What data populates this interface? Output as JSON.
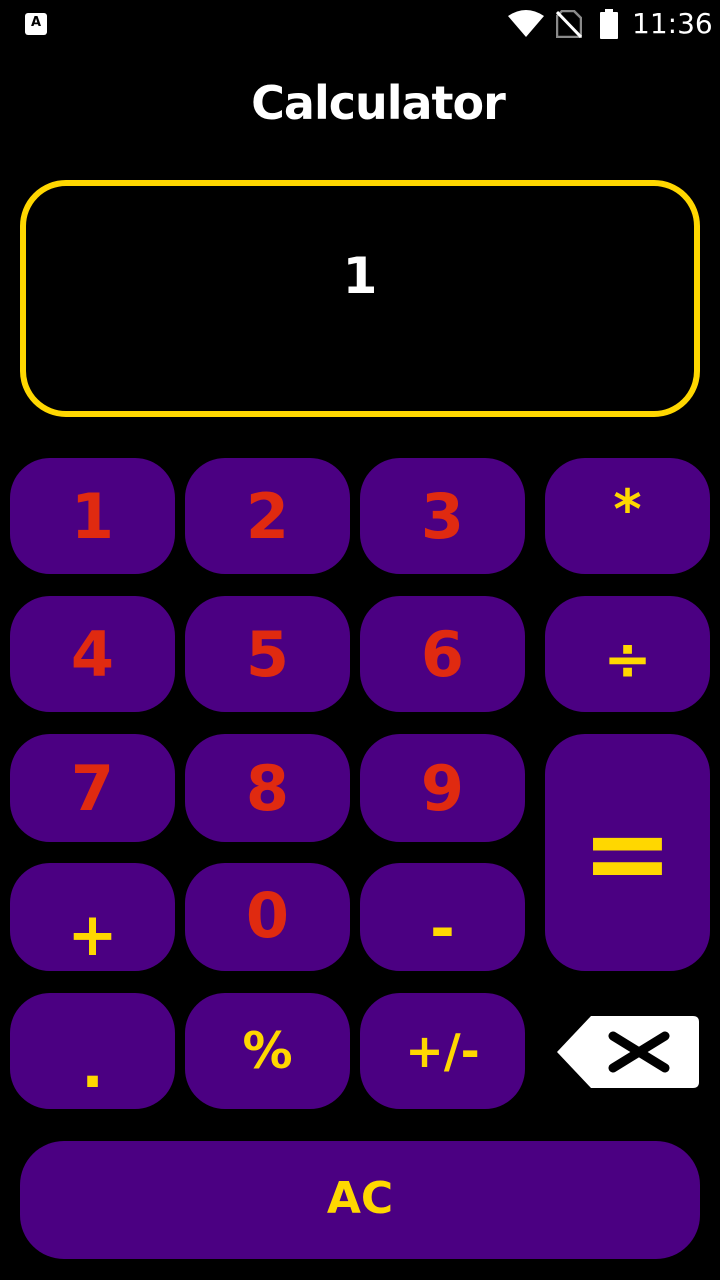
{
  "status_bar": {
    "app_icon_letter": "A",
    "time": "11:36"
  },
  "header": {
    "title": "Calculator"
  },
  "display": {
    "value": "1"
  },
  "keys": {
    "k1": "1",
    "k2": "2",
    "k3": "3",
    "multiply": "*",
    "k4": "4",
    "k5": "5",
    "k6": "6",
    "divide": "÷",
    "k7": "7",
    "k8": "8",
    "k9": "9",
    "equals": "=",
    "plus": "+",
    "k0": "0",
    "minus": "-",
    "decimal": ".",
    "percent": "%",
    "sign": "+/-",
    "clear": "AC"
  },
  "icons": {
    "backspace": "backspace-icon",
    "wifi": "wifi-icon",
    "no_sim": "no-sim-icon",
    "battery": "battery-icon"
  },
  "colors": {
    "background": "#000000",
    "key_fill": "#4B0082",
    "digit_text": "#E02A10",
    "operator_text": "#FFD700",
    "display_border": "#FFD700",
    "title_text": "#FFFFFF"
  }
}
